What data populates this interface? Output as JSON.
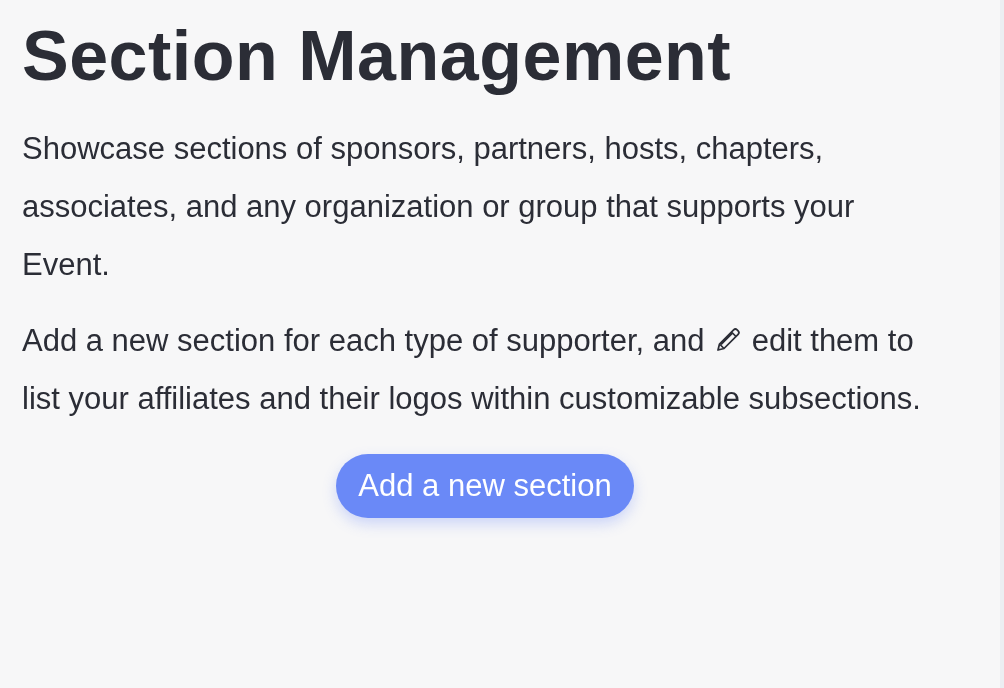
{
  "title": "Section Management",
  "paragraphs": [
    {
      "kind": "text",
      "text": "Showcase sections of sponsors, partners, hosts, chapters, associates, and any organization or group that supports your Event."
    },
    {
      "kind": "with_icon",
      "before": "Add a new section for each type of supporter, and",
      "after": "edit them to list your affiliates and their logos within customizable subsections."
    }
  ],
  "button": {
    "label": "Add a new section"
  }
}
